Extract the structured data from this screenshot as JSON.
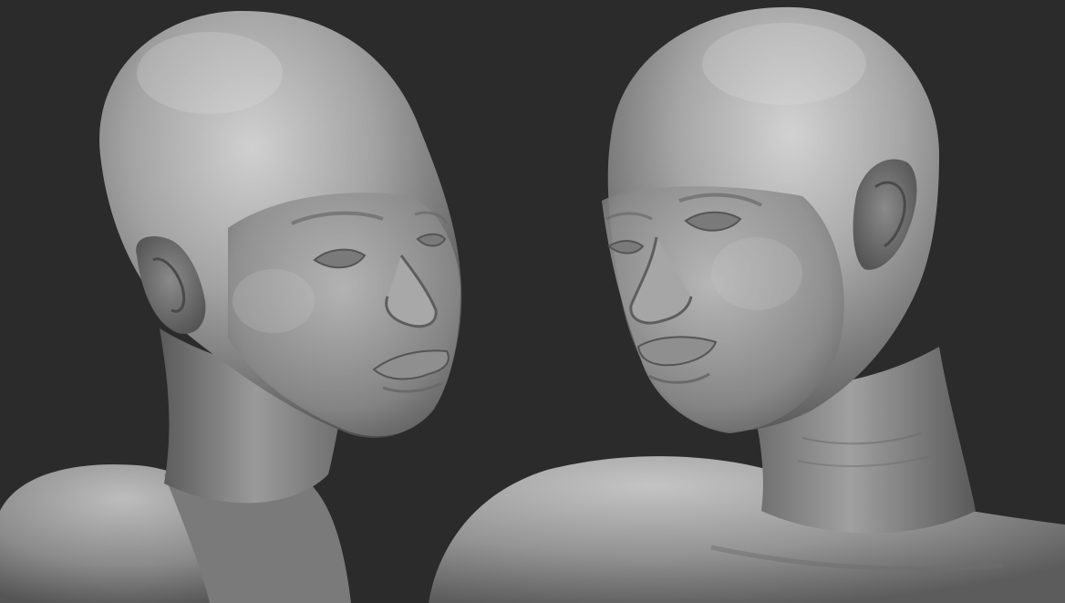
{
  "scene": {
    "background_color": "#2b2b2b",
    "clay_color": "#9c9c9c",
    "clay_highlight": "#d2d2d2",
    "clay_shadow": "#4a4a4a",
    "subjects": [
      "left-head-sculpt",
      "right-head-sculpt"
    ]
  }
}
